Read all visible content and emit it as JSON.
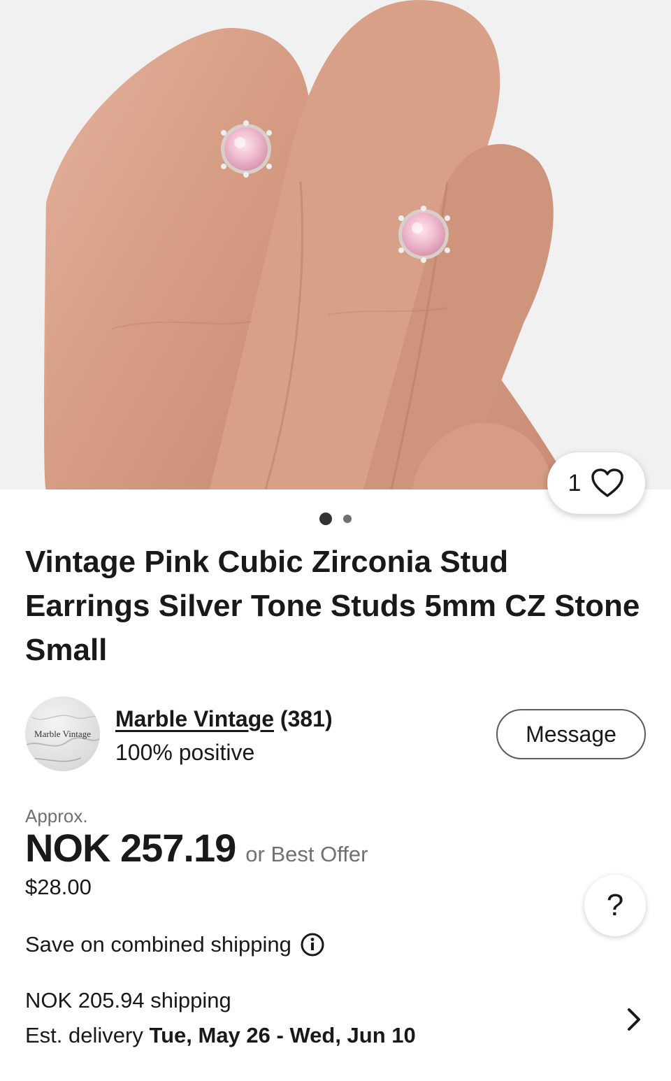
{
  "listing": {
    "image_alt": "Pink cubic zirconia stud earrings held on fingers",
    "watch_count": "1",
    "gallery": {
      "total_images": 2,
      "active_index": 0
    },
    "title": "Vintage Pink Cubic Zirconia Stud Earrings Silver Tone Studs 5mm CZ Stone Small"
  },
  "seller": {
    "avatar_text": "Marble Vintage",
    "name": "Marble Vintage",
    "feedback_count": "(381)",
    "positive": "100% positive",
    "message_label": "Message"
  },
  "price": {
    "approx_label": "Approx.",
    "amount": "NOK 257.19",
    "best_offer": "or Best Offer",
    "usd": "$28.00"
  },
  "help": {
    "label": "?"
  },
  "shipping": {
    "combined_label": "Save on combined shipping",
    "cost": "NOK 205.94 shipping",
    "delivery_prefix": "Est. delivery",
    "delivery_dates": "Tue, May 26 - Wed, Jun 10"
  },
  "colors": {
    "text": "#191919",
    "muted": "#707070",
    "skin": "#d9a38c",
    "stone": "#f0bfd0"
  },
  "icons": [
    "heart-icon",
    "info-icon",
    "chevron-right-icon"
  ]
}
